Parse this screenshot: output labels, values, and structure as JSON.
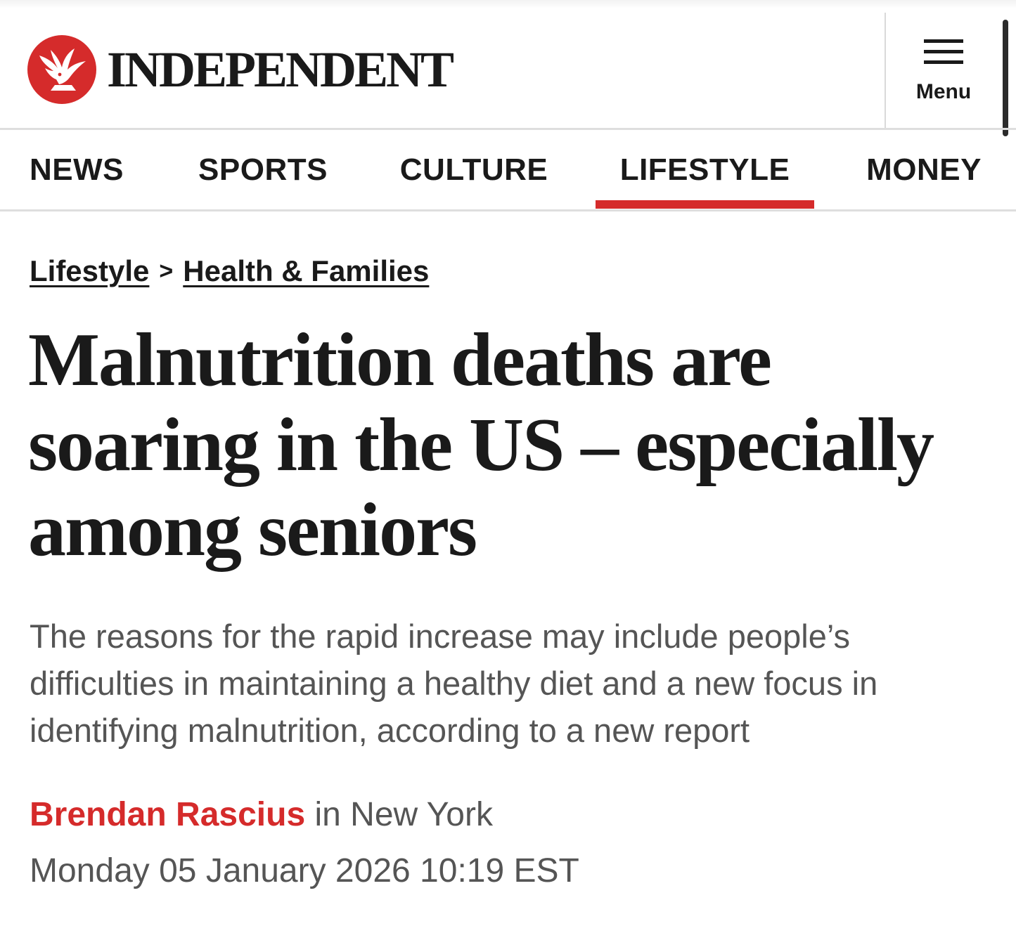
{
  "site": {
    "name": "INDEPENDENT",
    "logo_icon": "eagle-emblem-icon",
    "brand_color": "#d52b2b"
  },
  "header": {
    "menu_label": "Menu",
    "menu_icon": "hamburger-icon"
  },
  "nav": {
    "items": [
      {
        "label": "NEWS"
      },
      {
        "label": "SPORTS"
      },
      {
        "label": "CULTURE"
      },
      {
        "label": "LIFESTYLE"
      },
      {
        "label": "MONEY"
      }
    ],
    "active": "LIFESTYLE"
  },
  "breadcrumb": {
    "items": [
      {
        "label": "Lifestyle"
      },
      {
        "label": "Health & Families"
      }
    ],
    "separator": ">"
  },
  "article": {
    "headline": "Malnutrition deaths are soaring in the US – especially among seniors",
    "standfirst": "The reasons for the rapid increase may include people’s difficulties in maintaining a healthy diet and a new focus in identifying malnutrition, according to a new report",
    "author": "Brendan Rascius",
    "location": " in New York",
    "published": "Monday 05 January 2026 10:19 EST"
  }
}
